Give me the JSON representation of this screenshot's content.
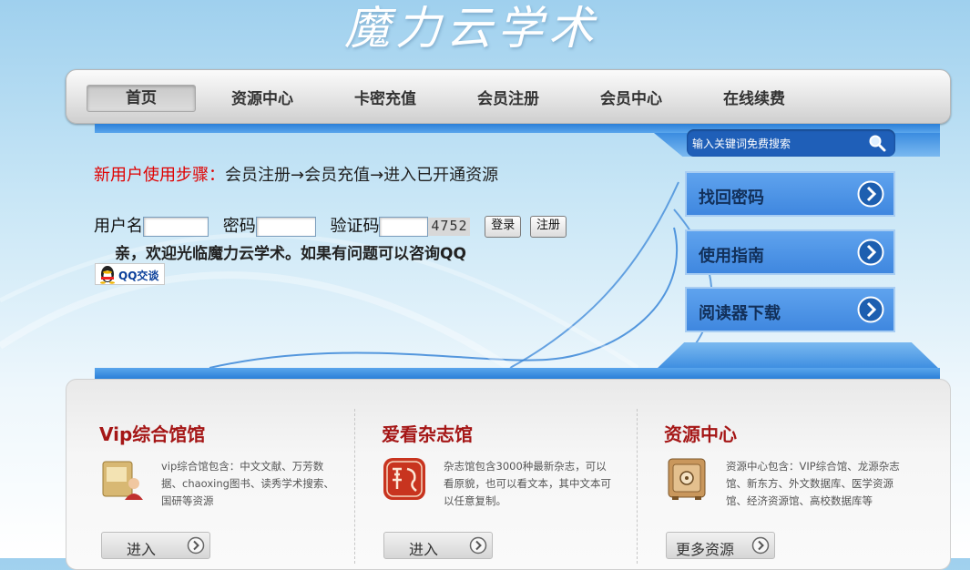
{
  "site": {
    "logo_text": "魔力云学术"
  },
  "nav": {
    "items": [
      {
        "label": "首页",
        "active": true
      },
      {
        "label": "资源中心"
      },
      {
        "label": "卡密充值"
      },
      {
        "label": "会员注册"
      },
      {
        "label": "会员中心"
      },
      {
        "label": "在线续费"
      }
    ]
  },
  "search": {
    "placeholder": "输入关键词免费搜索",
    "icon": "search-icon"
  },
  "side_buttons": [
    {
      "label": "找回密码",
      "icon": "arrow-right-circle-icon"
    },
    {
      "label": "使用指南",
      "icon": "arrow-right-circle-icon"
    },
    {
      "label": "阅读器下载",
      "icon": "arrow-right-circle-icon"
    }
  ],
  "steps": {
    "prefix": "新用户使用步骤：",
    "text": "会员注册→会员充值→进入已开通资源"
  },
  "login": {
    "username_label": "用户名",
    "password_label": "密码",
    "captcha_label": "验证码",
    "captcha_value": "4752",
    "login_button": "登录",
    "register_button": "注册"
  },
  "welcome_text": "亲，欢迎光临魔力云学术。如果有问题可以咨询QQ",
  "qq_button": "QQ交谈",
  "sections": [
    {
      "title": "Vip综合馆馆",
      "desc": "vip综合馆包含：中文文献、万芳数据、chaoxing图书、读秀学术搜索、国研等资源",
      "button": "进入",
      "icon": "folder-user-icon"
    },
    {
      "title": "爱看杂志馆",
      "desc": "杂志馆包含3000种最新杂志，可以看原貌，也可以看文本，其中文本可以任意复制。",
      "button": "进入",
      "icon": "dragon-seal-icon"
    },
    {
      "title": "资源中心",
      "desc": "资源中心包含：VIP综合馆、龙源杂志馆、新东方、外文数据库、医学资源馆、经济资源馆、高校数据库等",
      "button": "更多资源",
      "icon": "safe-icon"
    }
  ],
  "colors": {
    "accent_blue": "#3f87df",
    "title_red": "#a51616",
    "step_red": "#e00000"
  }
}
